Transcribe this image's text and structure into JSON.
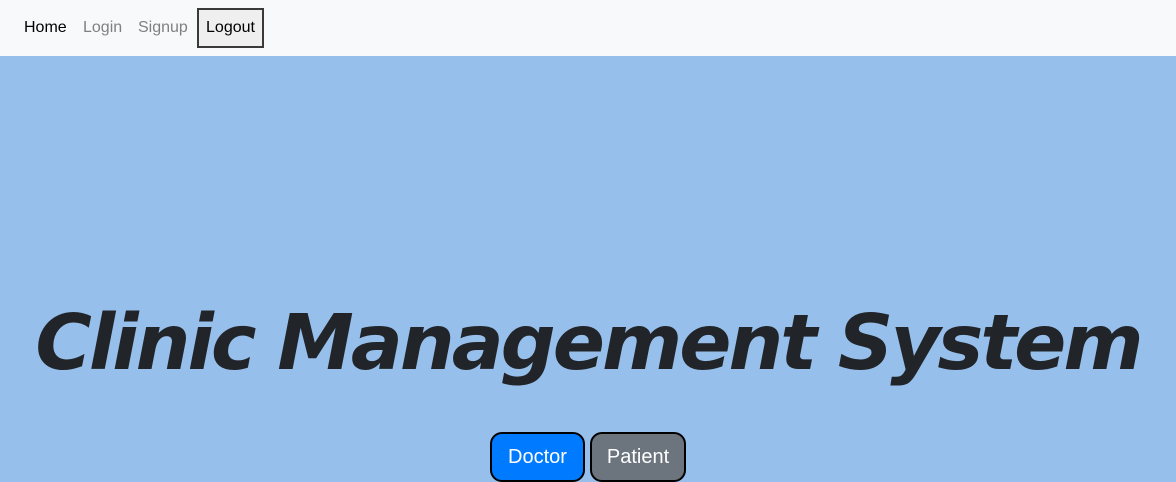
{
  "navbar": {
    "home_label": "Home",
    "login_label": "Login",
    "signup_label": "Signup",
    "logout_label": "Logout"
  },
  "hero": {
    "title": "Clinic Management System",
    "doctor_label": "Doctor",
    "patient_label": "Patient"
  },
  "colors": {
    "navbar_bg": "#f8f9fa",
    "hero_bg": "#97bfeb",
    "title_text": "#212529",
    "doctor_button": "#007bff",
    "patient_button": "#6c757d"
  }
}
